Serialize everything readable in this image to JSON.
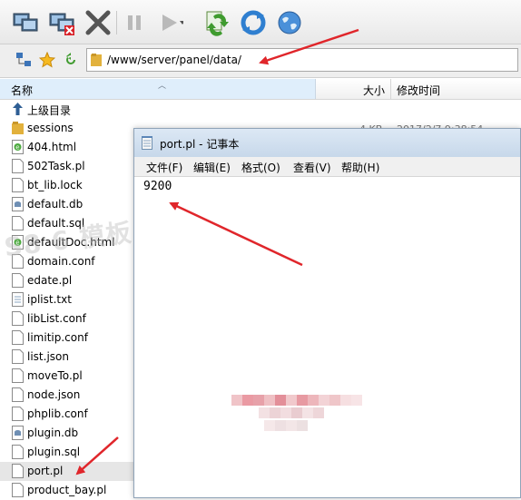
{
  "toolbar": {
    "buttons": [
      "connect-icon",
      "disconnect-icon",
      "stop-icon",
      "pause-icon",
      "play-icon",
      "sync-icon",
      "refresh-icon",
      "globe-icon"
    ]
  },
  "address_bar": {
    "path": "/www/server/panel/data/"
  },
  "file_list": {
    "columns": {
      "name": "名称",
      "size": "大小",
      "modified": "修改时间"
    },
    "items": [
      {
        "name": "上级目录",
        "icon": "up-arrow-icon"
      },
      {
        "name": "sessions",
        "icon": "folder-icon"
      },
      {
        "name": "404.html",
        "icon": "html-file-icon"
      },
      {
        "name": "502Task.pl",
        "icon": "file-icon"
      },
      {
        "name": "bt_lib.lock",
        "icon": "file-icon"
      },
      {
        "name": "default.db",
        "icon": "db-file-icon"
      },
      {
        "name": "default.sql",
        "icon": "file-icon"
      },
      {
        "name": "defaultDoc.html",
        "icon": "html-file-icon"
      },
      {
        "name": "domain.conf",
        "icon": "file-icon"
      },
      {
        "name": "edate.pl",
        "icon": "file-icon"
      },
      {
        "name": "iplist.txt",
        "icon": "text-file-icon"
      },
      {
        "name": "libList.conf",
        "icon": "file-icon"
      },
      {
        "name": "limitip.conf",
        "icon": "file-icon"
      },
      {
        "name": "list.json",
        "icon": "file-icon"
      },
      {
        "name": "moveTo.pl",
        "icon": "file-icon"
      },
      {
        "name": "node.json",
        "icon": "file-icon"
      },
      {
        "name": "phplib.conf",
        "icon": "file-icon"
      },
      {
        "name": "plugin.db",
        "icon": "db-file-icon"
      },
      {
        "name": "plugin.sql",
        "icon": "file-icon"
      },
      {
        "name": "port.pl",
        "icon": "file-icon",
        "selected": true
      },
      {
        "name": "product_bay.pl",
        "icon": "file-icon"
      }
    ],
    "partial_row": {
      "size": "4 KB",
      "modified": "2017/2/7 9:38:54"
    }
  },
  "watermark": "S8 6 模板",
  "notepad": {
    "title": "port.pl - 记事本",
    "menu": [
      "文件(F)",
      "编辑(E)",
      "格式(O)",
      "查看(V)",
      "帮助(H)"
    ],
    "content": "9200"
  },
  "colors": {
    "arrow": "#e0262b",
    "header_selected": "#dfeefb",
    "selected_row": "#e6e6e6"
  }
}
